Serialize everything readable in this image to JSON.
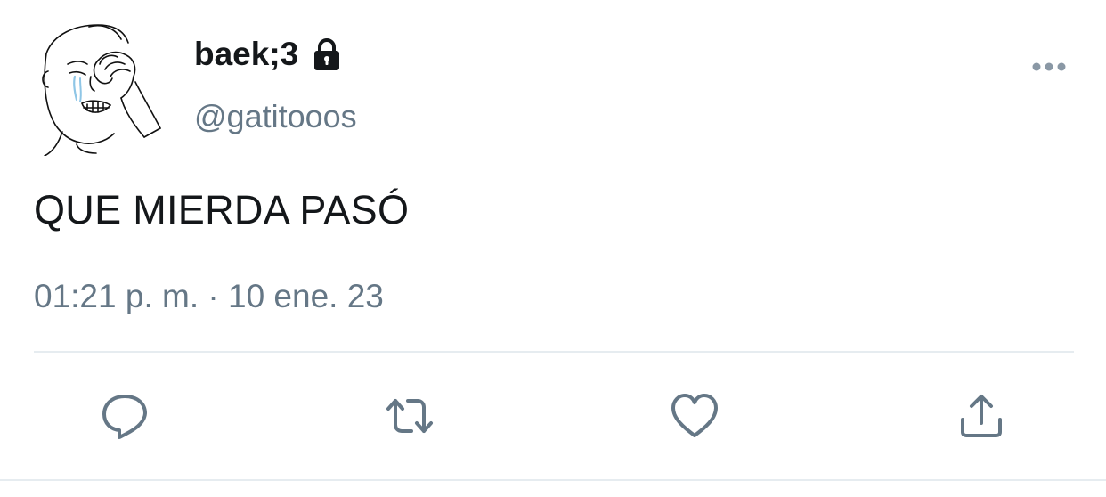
{
  "user": {
    "display_name": "baek;3",
    "handle": "@gatitooos",
    "protected": true,
    "avatar_icon": "crying-wojak-avatar"
  },
  "tweet": {
    "text": "QUE MIERDA PASÓ",
    "timestamp": "01:21 p. m. · 10 ene. 23"
  },
  "actions": [
    {
      "name": "reply",
      "icon": "speech-bubble-icon"
    },
    {
      "name": "retweet",
      "icon": "retweet-arrows-icon"
    },
    {
      "name": "like",
      "icon": "heart-icon"
    },
    {
      "name": "share",
      "icon": "share-upload-icon"
    }
  ],
  "colors": {
    "text": "#14171a",
    "secondary": "#657786",
    "divider": "#e6ecf0",
    "background": "#ffffff"
  }
}
